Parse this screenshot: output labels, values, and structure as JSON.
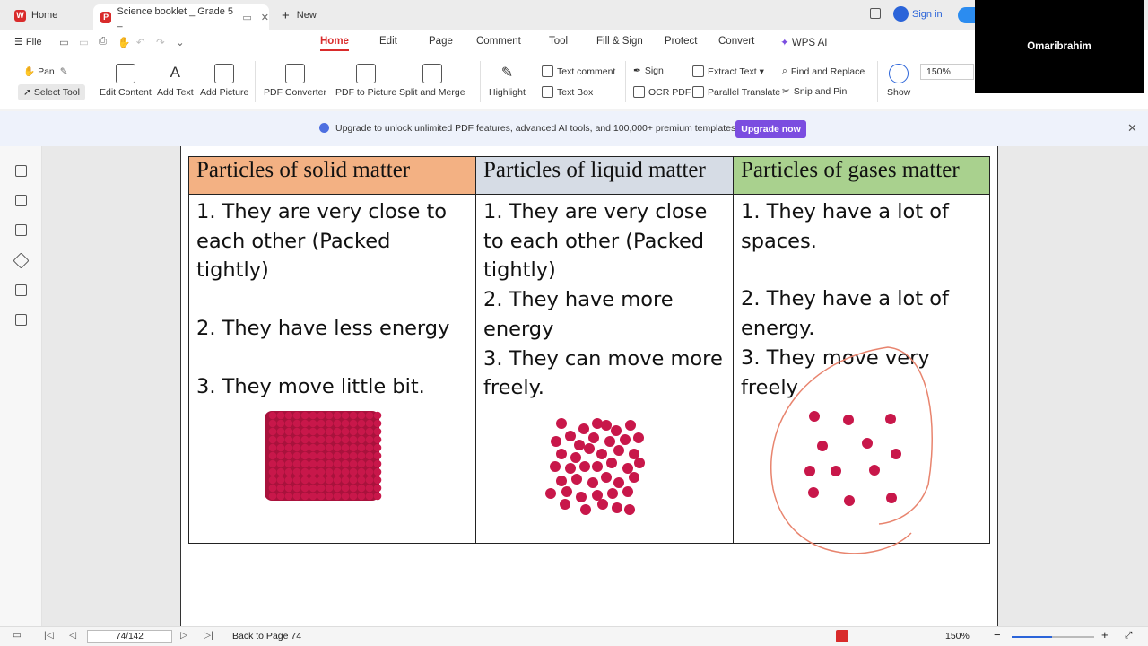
{
  "tabs": {
    "home": "Home",
    "doc": "Science booklet _ Grade 5 _",
    "new": "New"
  },
  "account": {
    "signin": "Sign in"
  },
  "menu": {
    "file": "File",
    "items": [
      "Home",
      "Edit",
      "Page",
      "Comment",
      "Tool",
      "Fill & Sign",
      "Protect",
      "Convert",
      "WPS AI"
    ],
    "active": "Home"
  },
  "ribbon": {
    "pan": "Pan",
    "select": "Select Tool",
    "edit_content": "Edit Content",
    "add_text": "Add Text",
    "add_picture": "Add Picture",
    "pdf_converter": "PDF Converter",
    "pdf_to_picture": "PDF to Picture",
    "split_merge": "Split and Merge",
    "highlight": "Highlight",
    "text_comment": "Text comment",
    "text_box": "Text Box",
    "sign": "Sign",
    "ocr": "OCR PDF",
    "extract": "Extract Text",
    "parallel": "Parallel Translate",
    "find_replace": "Find and Replace",
    "snip": "Snip and Pin",
    "show": "Show",
    "zoom": "150%"
  },
  "banner": {
    "text": "Upgrade to unlock unlimited PDF features, advanced AI tools, and 100,000+ premium templates.",
    "button": "Upgrade now"
  },
  "table": {
    "headers": [
      {
        "text": "Particles of solid matter",
        "color": "#f3b183"
      },
      {
        "text": "Particles of liquid matter",
        "color": "#d6dce5"
      },
      {
        "text": "Particles of gases matter",
        "color": "#a9d18e"
      }
    ],
    "cells": [
      [
        "1. They are very close to each other (Packed tightly)",
        "",
        "2. They have less energy",
        "",
        "3. They move little bit."
      ],
      [
        "1. They are very close to each other (Packed tightly)",
        "2. They have more energy",
        "3. They can move more freely."
      ],
      [
        "1. They have a lot of spaces.",
        "",
        "2. They have a lot of energy.",
        "3. They move very freely"
      ]
    ]
  },
  "video": {
    "name": "Omaribrahim"
  },
  "status": {
    "page": "74/142",
    "back": "Back to Page 74",
    "zoom": "150%"
  },
  "colors": {
    "accent": "#d92b2b",
    "particle": "#c8174a",
    "annotation": "#e8846e",
    "upgrade": "#7b4de0"
  }
}
